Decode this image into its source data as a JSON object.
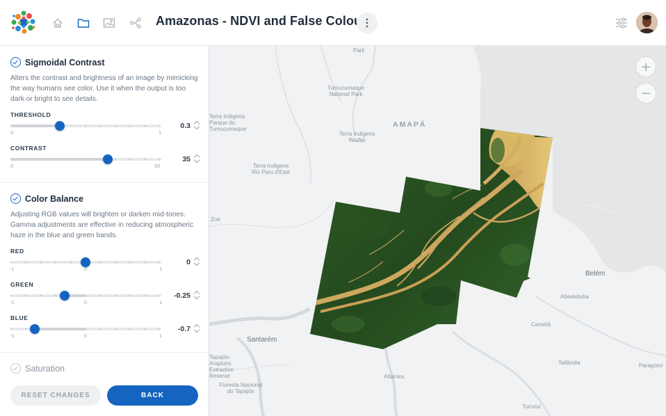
{
  "header": {
    "title": "Amazonas - NDVI and False Colour",
    "nav_icons": [
      "home-icon",
      "folder-icon",
      "image-icon",
      "share-icon"
    ],
    "more_icon": "vertical-dots-icon",
    "settings_icon": "sliders-icon",
    "avatar": "user-avatar"
  },
  "panel": {
    "sigmoidal": {
      "title": "Sigmoidal Contrast",
      "description": "Alters the contrast and brightness of an image by mimicking the way humans see color. Use it when the output is too dark or bright to see details.",
      "sliders": [
        {
          "label": "THRESHOLD",
          "min": "0",
          "max": "1",
          "value": "0.3",
          "fraction": 0.33
        },
        {
          "label": "CONTRAST",
          "min": "0",
          "max": "50",
          "value": "35",
          "fraction": 0.65
        }
      ]
    },
    "color_balance": {
      "title": "Color Balance",
      "description": "Adjusting RGB values will brighten or darken mid-tones. Gamma adjustments are effective in reducing atmospheric haze in the blue and green bands.",
      "sliders": [
        {
          "label": "RED",
          "min": "-1",
          "mid": "0",
          "max": "1",
          "value": "0",
          "fraction": 0.5
        },
        {
          "label": "GREEN",
          "min": "-1",
          "mid": "0",
          "max": "1",
          "value": "-0.25",
          "fraction": 0.36
        },
        {
          "label": "BLUE",
          "min": "-1",
          "mid": "0",
          "max": "1",
          "value": "-0.7",
          "fraction": 0.16
        }
      ]
    },
    "saturation": {
      "title": "Saturation"
    },
    "buttons": {
      "reset": "RESET CHANGES",
      "back": "BACK"
    }
  },
  "map": {
    "zoom_in": "+",
    "zoom_out": "−",
    "labels": {
      "park": "Park",
      "tumucumaque": "Tumucumaque\nNational Park",
      "terra_parque": "Terra Indigena\nParque do\nTumucumaque",
      "amapa": "AMAPÁ",
      "waiapi": "Terra Indigena\nWaiãpi",
      "rio_paru": "Terra Indigena\nRio Paru d'Este",
      "zoe": "Zoé",
      "belem": "Belém",
      "abaetetuba": "Abaetetuba",
      "cameta": "Cametá",
      "santarem": "Santarém",
      "tapajos_reserve": "Tapajós-\nArapiuns\nExtractive\nReserve",
      "floresta": "Floresta Nacional\ndo Tapajós",
      "altamira": "Altamira",
      "tailandia": "Tailândia",
      "paragominas": "Paragomi",
      "tucurui": "Tucuruí"
    }
  }
}
